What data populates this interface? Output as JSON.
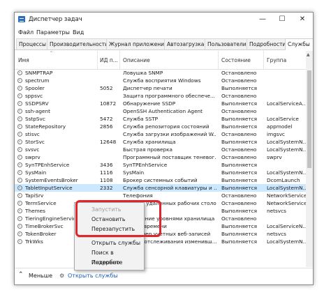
{
  "window": {
    "title": "Диспетчер задач",
    "controls": [
      "—",
      "☐",
      "✕"
    ]
  },
  "menu": [
    "Файл",
    "Параметры",
    "Вид"
  ],
  "tabs": [
    {
      "label": "Процессы",
      "active": false
    },
    {
      "label": "Производительность",
      "active": false
    },
    {
      "label": "Журнал приложений",
      "active": false
    },
    {
      "label": "Автозагрузка",
      "active": false
    },
    {
      "label": "Пользователи",
      "active": false
    },
    {
      "label": "Подробности",
      "active": false
    },
    {
      "label": "Службы",
      "active": true
    }
  ],
  "columns": {
    "name": "Имя",
    "pid": "ИД п...",
    "desc": "Описание",
    "state": "Состояние",
    "group": "Группа"
  },
  "services": [
    {
      "name": "SNMPTRAP",
      "pid": "",
      "desc": "Ловушка SNMP",
      "state": "Остановлено",
      "group": ""
    },
    {
      "name": "spectrum",
      "pid": "",
      "desc": "Служба восприятия Windows",
      "state": "Остановлено",
      "group": ""
    },
    {
      "name": "Spooler",
      "pid": "5052",
      "desc": "Диспетчер печати",
      "state": "Выполняется",
      "group": ""
    },
    {
      "name": "sppsvc",
      "pid": "",
      "desc": "Защита программного обеспече...",
      "state": "Остановлено",
      "group": ""
    },
    {
      "name": "SSDPSRV",
      "pid": "10872",
      "desc": "Обнаружение SSDP",
      "state": "Выполняется",
      "group": "LocalServiceA..."
    },
    {
      "name": "ssh-agent",
      "pid": "",
      "desc": "OpenSSH Authentication Agent",
      "state": "Остановлено",
      "group": ""
    },
    {
      "name": "SstpSvc",
      "pid": "5472",
      "desc": "Служба SSTP",
      "state": "Выполняется",
      "group": "LocalService"
    },
    {
      "name": "StateRepository",
      "pid": "2856",
      "desc": "Служба репозитория состояний",
      "state": "Выполняется",
      "group": "appmodel"
    },
    {
      "name": "stisvc",
      "pid": "",
      "desc": "Служба загрузки изображений W...",
      "state": "Остановлено",
      "group": "imgsvc"
    },
    {
      "name": "StorSvc",
      "pid": "12648",
      "desc": "Служба хранилища",
      "state": "Выполняется",
      "group": "LocalSystemN..."
    },
    {
      "name": "svsvc",
      "pid": "",
      "desc": "Быстрая проверка",
      "state": "Остановлено",
      "group": "LocalSystemN..."
    },
    {
      "name": "swprv",
      "pid": "",
      "desc": "Программный поставщик теневог...",
      "state": "Остановлено",
      "group": "swprv"
    },
    {
      "name": "SynTPEnhService",
      "pid": "3436",
      "desc": "SynTPEnhService",
      "state": "Выполняется",
      "group": ""
    },
    {
      "name": "SysMain",
      "pid": "1116",
      "desc": "SysMain",
      "state": "Выполняется",
      "group": "LocalSystemN..."
    },
    {
      "name": "SystemEventsBroker",
      "pid": "1108",
      "desc": "Брокер системных событий",
      "state": "Выполняется",
      "group": "DcomLaunch"
    },
    {
      "name": "TabletInputService",
      "pid": "2332",
      "desc": "Служба сенсорной клавиатуры и ...",
      "state": "Выполняется",
      "group": "LocalSystemN...",
      "selected": true
    },
    {
      "name": "TapiSrv",
      "pid": "",
      "desc": "Телефония",
      "state": "Остановлено",
      "group": "NetworkService"
    },
    {
      "name": "TermService",
      "pid": "",
      "desc": "Службы удаленных рабочих столов",
      "state": "Остановлено",
      "group": "NetworkService"
    },
    {
      "name": "Themes",
      "pid": "",
      "desc": "Темы",
      "state": "Выполняется",
      "group": "netsvcs"
    },
    {
      "name": "TieringEngineService",
      "pid": "",
      "desc": "Управление уровнями хранилища",
      "state": "Остановлено",
      "group": ""
    },
    {
      "name": "TimeBrokerSvc",
      "pid": "",
      "desc": "Брокер времени",
      "state": "Выполняется",
      "group": "LocalServiceN..."
    },
    {
      "name": "TokenBroker",
      "pid": "",
      "desc": "Диспетчер учетных веб-записей",
      "state": "Выполняется",
      "group": "netsvcs"
    },
    {
      "name": "TrkWks",
      "pid": "",
      "desc": "Клиент отслеживания изменивш...",
      "state": "Выполняется",
      "group": "LocalSystemN..."
    }
  ],
  "context_menu": {
    "start": "Запустить",
    "stop": "Остановить",
    "restart": "Перезапустить",
    "open_services": "Открыть службы",
    "search_web": "Поиск в Интернете",
    "details": "Подробно"
  },
  "footer": {
    "less": "Меньше",
    "open_services": "Открыть службы"
  },
  "colors": {
    "selection": "#cce8ff",
    "highlight": "#e2242c",
    "link": "#1a5fb4"
  }
}
